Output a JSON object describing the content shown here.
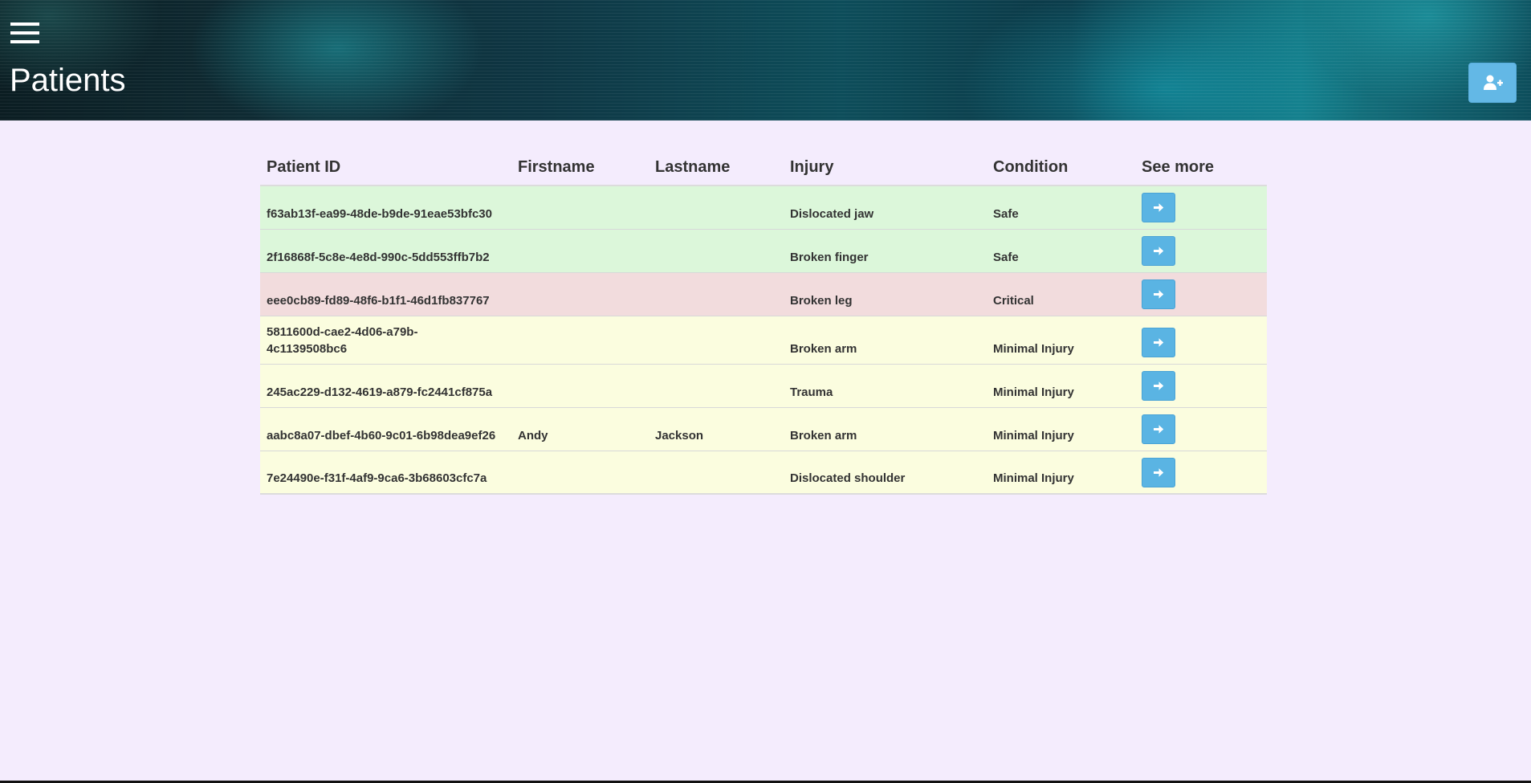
{
  "header": {
    "title": "Patients",
    "menu_icon": "hamburger-menu-icon",
    "add_icon": "user-plus-icon"
  },
  "table": {
    "columns": [
      "Patient ID",
      "Firstname",
      "Lastname",
      "Injury",
      "Condition",
      "See more"
    ],
    "rows": [
      {
        "id": "f63ab13f-ea99-48de-b9de-91eae53bfc30",
        "firstname": "",
        "lastname": "",
        "injury": "Dislocated jaw",
        "condition": "Safe"
      },
      {
        "id": "2f16868f-5c8e-4e8d-990c-5dd553ffb7b2",
        "firstname": "",
        "lastname": "",
        "injury": "Broken finger",
        "condition": "Safe"
      },
      {
        "id": "eee0cb89-fd89-48f6-b1f1-46d1fb837767",
        "firstname": "",
        "lastname": "",
        "injury": "Broken leg",
        "condition": "Critical"
      },
      {
        "id": "5811600d-cae2-4d06-a79b-4c1139508bc6",
        "firstname": "",
        "lastname": "",
        "injury": "Broken arm",
        "condition": "Minimal Injury"
      },
      {
        "id": "245ac229-d132-4619-a879-fc2441cf875a",
        "firstname": "",
        "lastname": "",
        "injury": "Trauma",
        "condition": "Minimal Injury"
      },
      {
        "id": "aabc8a07-dbef-4b60-9c01-6b98dea9ef26",
        "firstname": "Andy",
        "lastname": "Jackson",
        "injury": "Broken arm",
        "condition": "Minimal Injury"
      },
      {
        "id": "7e24490e-f31f-4af9-9ca6-3b68603cfc7a",
        "firstname": "",
        "lastname": "",
        "injury": "Dislocated shoulder",
        "condition": "Minimal Injury"
      }
    ],
    "see_more_icon": "arrow-right-icon"
  },
  "colors": {
    "background": "#f4ecfd",
    "safe_row": "#dcf7da",
    "critical_row": "#f2dcdd",
    "minimal_row": "#fbfddf",
    "button": "#5ab4e3"
  }
}
